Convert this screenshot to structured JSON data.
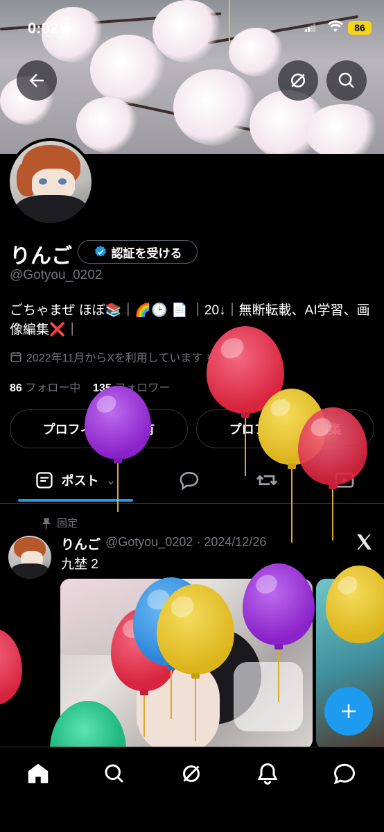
{
  "status_bar": {
    "time": "0:02",
    "battery": "86"
  },
  "header": {
    "back_icon": "arrow-left-icon",
    "grok_icon": "grok-icon",
    "search_icon": "search-icon"
  },
  "profile": {
    "display_name": "りんご",
    "verify_label": "認証を受ける",
    "handle": "@Gotyou_0202",
    "bio": "ごちゃまぜ ほぼ📚｜🌈🕒 📄 ｜20↓｜無断転載、AI学習、画像編集❌｜",
    "joined": "2022年11月からXを利用しています",
    "following_count": "86",
    "following_label": "フォロー中",
    "followers_count": "135",
    "followers_label": "フォロワー",
    "share_label": "プロフィールを共有",
    "edit_label": "プロフィールを編集"
  },
  "tabs": {
    "posts_label": "ポスト",
    "items": [
      "posts",
      "replies",
      "reposts",
      "media"
    ]
  },
  "pinned_post": {
    "pinned_label": "固定",
    "author": "りんご",
    "meta": "@Gotyou_0202 · 2024/12/26",
    "text": "九埜 2"
  },
  "bottom_nav": [
    "home-icon",
    "search-icon",
    "grok-icon",
    "bell-icon",
    "messages-icon"
  ],
  "colors": {
    "accent": "#1d9bf0",
    "background": "#000000",
    "secondary_text": "#71767b",
    "balloon_red": "#e8354f",
    "balloon_purple": "#9a2fd6",
    "balloon_yellow": "#e8c22a",
    "balloon_blue": "#3b9be8",
    "balloon_green": "#2fcf95"
  }
}
